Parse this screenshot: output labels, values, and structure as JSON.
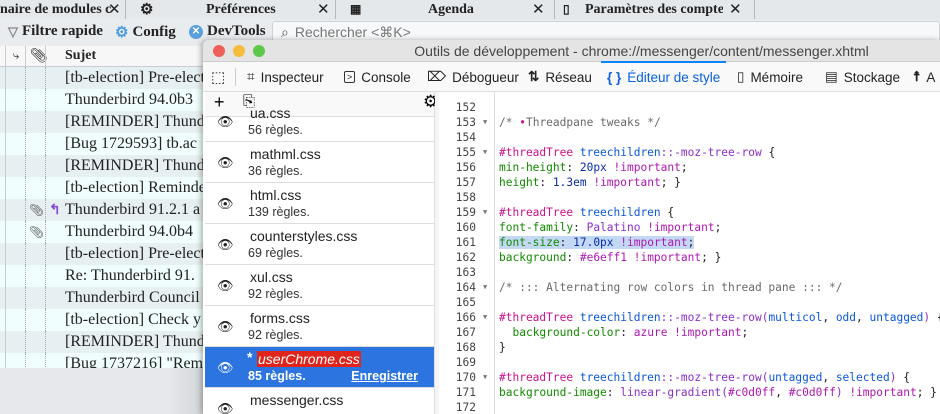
{
  "tabs": [
    {
      "label": "naire de modules c",
      "close": "✕"
    },
    {
      "label": "Préférences",
      "icon": "gear-icon",
      "close": "✕"
    },
    {
      "label": "Agenda",
      "icon": "calendar-icon",
      "close": "✕"
    },
    {
      "label": "Paramètres des comptes C",
      "icon": "accounts-icon",
      "close": "✕"
    }
  ],
  "toolbar": {
    "quick_filter": "Filtre rapide",
    "config": "Config",
    "devtools": "DevTools",
    "search_placeholder": "Rechercher <⌘K>"
  },
  "message_list": {
    "subject_header": "Sujet",
    "rows": [
      {
        "subject": "[tb-election] Pre-election",
        "attach": false,
        "replied": false
      },
      {
        "subject": "Thunderbird 94.0b3",
        "attach": false,
        "replied": false
      },
      {
        "subject": "[REMINDER] Thunderbird",
        "attach": false,
        "replied": false
      },
      {
        "subject": "[Bug 1729593] tb.ac",
        "attach": false,
        "replied": false
      },
      {
        "subject": "[REMINDER] Thunderbird",
        "attach": false,
        "replied": false
      },
      {
        "subject": "[tb-election] Reminder",
        "attach": false,
        "replied": false
      },
      {
        "subject": "Thunderbird 91.2.1 a",
        "attach": true,
        "replied": true
      },
      {
        "subject": "Thunderbird 94.0b4",
        "attach": true,
        "replied": false
      },
      {
        "subject": "[tb-election] Pre-election",
        "attach": false,
        "replied": false
      },
      {
        "subject": "Re: Thunderbird 91.",
        "attach": false,
        "replied": false
      },
      {
        "subject": "Thunderbird Council",
        "attach": false,
        "replied": false
      },
      {
        "subject": "[tb-election] Check y",
        "attach": false,
        "replied": false
      },
      {
        "subject": "[REMINDER] Thunderbird",
        "attach": false,
        "replied": false
      },
      {
        "subject": "[Bug 1737216] \"Rem",
        "attach": false,
        "replied": false
      }
    ]
  },
  "devtools": {
    "title": "Outils de développement - chrome://messenger/content/messenger.xhtml",
    "tools": [
      {
        "label": "",
        "icon": "picker-icon"
      },
      {
        "label": "Inspecteur",
        "icon": "inspector-icon"
      },
      {
        "label": "Console",
        "icon": "console-icon"
      },
      {
        "label": "Débogueur",
        "icon": "debugger-icon"
      },
      {
        "label": "Réseau",
        "icon": "network-icon"
      },
      {
        "label": "Éditeur de style",
        "icon": "braces-icon",
        "selected": true
      },
      {
        "label": "Mémoire",
        "icon": "memory-icon"
      },
      {
        "label": "Stockage",
        "icon": "storage-icon"
      },
      {
        "label": "A",
        "icon": "accessibility-icon"
      }
    ],
    "sheets": [
      {
        "name": "ua.css",
        "rules": "56 règles."
      },
      {
        "name": "mathml.css",
        "rules": "36 règles."
      },
      {
        "name": "html.css",
        "rules": "139 règles."
      },
      {
        "name": "counterstyles.css",
        "rules": "69 règles."
      },
      {
        "name": "xul.css",
        "rules": "92 règles."
      },
      {
        "name": "forms.css",
        "rules": "92 règles."
      },
      {
        "name": "userChrome.css",
        "rules": "85 règles.",
        "selected": true,
        "modified": "*",
        "save": "Enregistrer"
      },
      {
        "name": "messenger.css",
        "rules": ""
      }
    ],
    "code": [
      {
        "n": "152",
        "fold": false,
        "tokens": []
      },
      {
        "n": "153",
        "fold": true,
        "tokens": [
          [
            "c",
            "/* "
          ],
          [
            "s",
            "•"
          ],
          [
            "c",
            "Threadpane tweaks */"
          ]
        ]
      },
      {
        "n": "154",
        "fold": false,
        "tokens": []
      },
      {
        "n": "155",
        "fold": true,
        "tokens": [
          [
            "s",
            "#threadTree "
          ],
          [
            "t",
            "treechildren"
          ],
          [
            "k",
            "::-moz-tree-row"
          ],
          [
            "pl",
            " {"
          ]
        ]
      },
      {
        "n": "156",
        "fold": false,
        "tokens": [
          [
            "p",
            "min-height"
          ],
          [
            "pl",
            ": "
          ],
          [
            "n",
            "20px "
          ],
          [
            "i",
            "!important"
          ],
          [
            "pl",
            ";"
          ]
        ]
      },
      {
        "n": "157",
        "fold": false,
        "tokens": [
          [
            "p",
            "height"
          ],
          [
            "pl",
            ": "
          ],
          [
            "n",
            "1.3em "
          ],
          [
            "i",
            "!important"
          ],
          [
            "pl",
            "; }"
          ]
        ]
      },
      {
        "n": "158",
        "fold": false,
        "tokens": []
      },
      {
        "n": "159",
        "fold": true,
        "tokens": [
          [
            "s",
            "#threadTree "
          ],
          [
            "t",
            "treechildren"
          ],
          [
            "pl",
            " {"
          ]
        ]
      },
      {
        "n": "160",
        "fold": false,
        "tokens": [
          [
            "p",
            "font-family"
          ],
          [
            "pl",
            ": "
          ],
          [
            "k",
            "Palatino "
          ],
          [
            "i",
            "!important"
          ],
          [
            "pl",
            ";"
          ]
        ]
      },
      {
        "n": "161",
        "fold": false,
        "highlight": true,
        "tokens": [
          [
            "p",
            "font-size"
          ],
          [
            "pl",
            ": "
          ],
          [
            "n",
            "17.0px "
          ],
          [
            "i",
            "!important"
          ],
          [
            "pl",
            ";"
          ]
        ]
      },
      {
        "n": "162",
        "fold": false,
        "tokens": [
          [
            "p",
            "background"
          ],
          [
            "pl",
            ": "
          ],
          [
            "i",
            "#e6eff1 !important"
          ],
          [
            "pl",
            "; }"
          ]
        ]
      },
      {
        "n": "163",
        "fold": false,
        "tokens": []
      },
      {
        "n": "164",
        "fold": true,
        "tokens": [
          [
            "c",
            "/* ::: Alternating row colors in thread pane ::: */"
          ]
        ]
      },
      {
        "n": "165",
        "fold": false,
        "tokens": []
      },
      {
        "n": "166",
        "fold": true,
        "tokens": [
          [
            "s",
            "#threadTree "
          ],
          [
            "t",
            "treechildren"
          ],
          [
            "k",
            "::-moz-tree-row("
          ],
          [
            "t",
            "multicol"
          ],
          [
            "pl",
            ", "
          ],
          [
            "t",
            "odd"
          ],
          [
            "pl",
            ", "
          ],
          [
            "t",
            "untagged"
          ],
          [
            "k",
            ")"
          ],
          [
            "pl",
            " {"
          ]
        ]
      },
      {
        "n": "167",
        "fold": false,
        "tokens": [
          [
            "pl",
            "  "
          ],
          [
            "p",
            "background-color"
          ],
          [
            "pl",
            ": "
          ],
          [
            "i",
            "azure !important"
          ],
          [
            "pl",
            ";"
          ]
        ]
      },
      {
        "n": "168",
        "fold": false,
        "tokens": [
          [
            "pl",
            "}"
          ]
        ]
      },
      {
        "n": "169",
        "fold": false,
        "tokens": []
      },
      {
        "n": "170",
        "fold": true,
        "tokens": [
          [
            "s",
            "#threadTree "
          ],
          [
            "t",
            "treechildren"
          ],
          [
            "k",
            "::-moz-tree-row("
          ],
          [
            "t",
            "untagged"
          ],
          [
            "pl",
            ", "
          ],
          [
            "t",
            "selected"
          ],
          [
            "k",
            ")"
          ],
          [
            "pl",
            " {"
          ]
        ]
      },
      {
        "n": "171",
        "fold": false,
        "tokens": [
          [
            "p",
            "background-image"
          ],
          [
            "pl",
            ": "
          ],
          [
            "k",
            "linear-gradient("
          ],
          [
            "i",
            "#c0d0ff"
          ],
          [
            "pl",
            ", "
          ],
          [
            "i",
            "#c0d0ff"
          ],
          [
            "k",
            ")"
          ],
          [
            "i",
            " !important"
          ],
          [
            "pl",
            "; }"
          ]
        ]
      },
      {
        "n": "172",
        "fold": false,
        "tokens": []
      }
    ]
  },
  "colors": {
    "accent": "#0a84ff",
    "selected_sheet": "#2c74e0",
    "odd_row": "#e6eff1",
    "even_row": "#f0fefe"
  }
}
